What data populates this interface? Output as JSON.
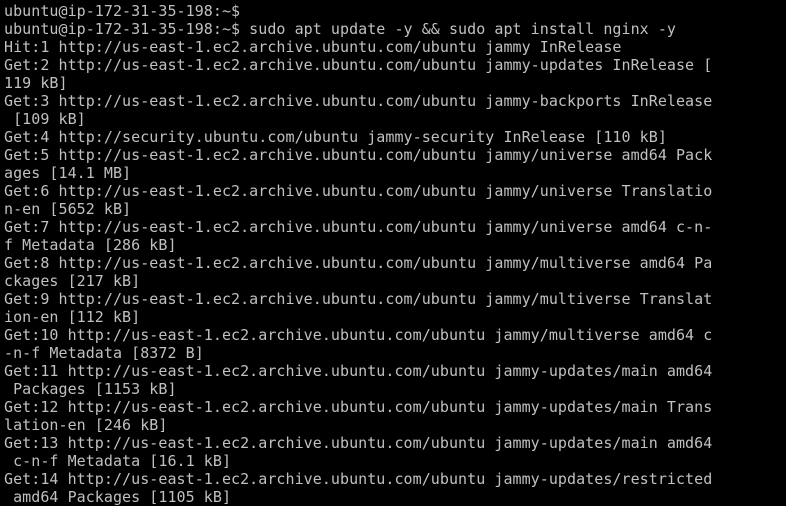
{
  "terminal": {
    "colors": {
      "background": "#000000",
      "foreground": "#c0c0c0"
    },
    "lines": [
      "ubuntu@ip-172-31-35-198:~$",
      "ubuntu@ip-172-31-35-198:~$ sudo apt update -y && sudo apt install nginx -y",
      "Hit:1 http://us-east-1.ec2.archive.ubuntu.com/ubuntu jammy InRelease",
      "Get:2 http://us-east-1.ec2.archive.ubuntu.com/ubuntu jammy-updates InRelease [",
      "119 kB]",
      "Get:3 http://us-east-1.ec2.archive.ubuntu.com/ubuntu jammy-backports InRelease",
      " [109 kB]",
      "Get:4 http://security.ubuntu.com/ubuntu jammy-security InRelease [110 kB]",
      "Get:5 http://us-east-1.ec2.archive.ubuntu.com/ubuntu jammy/universe amd64 Pack",
      "ages [14.1 MB]",
      "Get:6 http://us-east-1.ec2.archive.ubuntu.com/ubuntu jammy/universe Translatio",
      "n-en [5652 kB]",
      "Get:7 http://us-east-1.ec2.archive.ubuntu.com/ubuntu jammy/universe amd64 c-n-",
      "f Metadata [286 kB]",
      "Get:8 http://us-east-1.ec2.archive.ubuntu.com/ubuntu jammy/multiverse amd64 Pa",
      "ckages [217 kB]",
      "Get:9 http://us-east-1.ec2.archive.ubuntu.com/ubuntu jammy/multiverse Translat",
      "ion-en [112 kB]",
      "Get:10 http://us-east-1.ec2.archive.ubuntu.com/ubuntu jammy/multiverse amd64 c",
      "-n-f Metadata [8372 B]",
      "Get:11 http://us-east-1.ec2.archive.ubuntu.com/ubuntu jammy-updates/main amd64",
      " Packages [1153 kB]",
      "Get:12 http://us-east-1.ec2.archive.ubuntu.com/ubuntu jammy-updates/main Trans",
      "lation-en [246 kB]",
      "Get:13 http://us-east-1.ec2.archive.ubuntu.com/ubuntu jammy-updates/main amd64",
      " c-n-f Metadata [16.1 kB]",
      "Get:14 http://us-east-1.ec2.archive.ubuntu.com/ubuntu jammy-updates/restricted",
      " amd64 Packages [1105 kB]"
    ]
  }
}
